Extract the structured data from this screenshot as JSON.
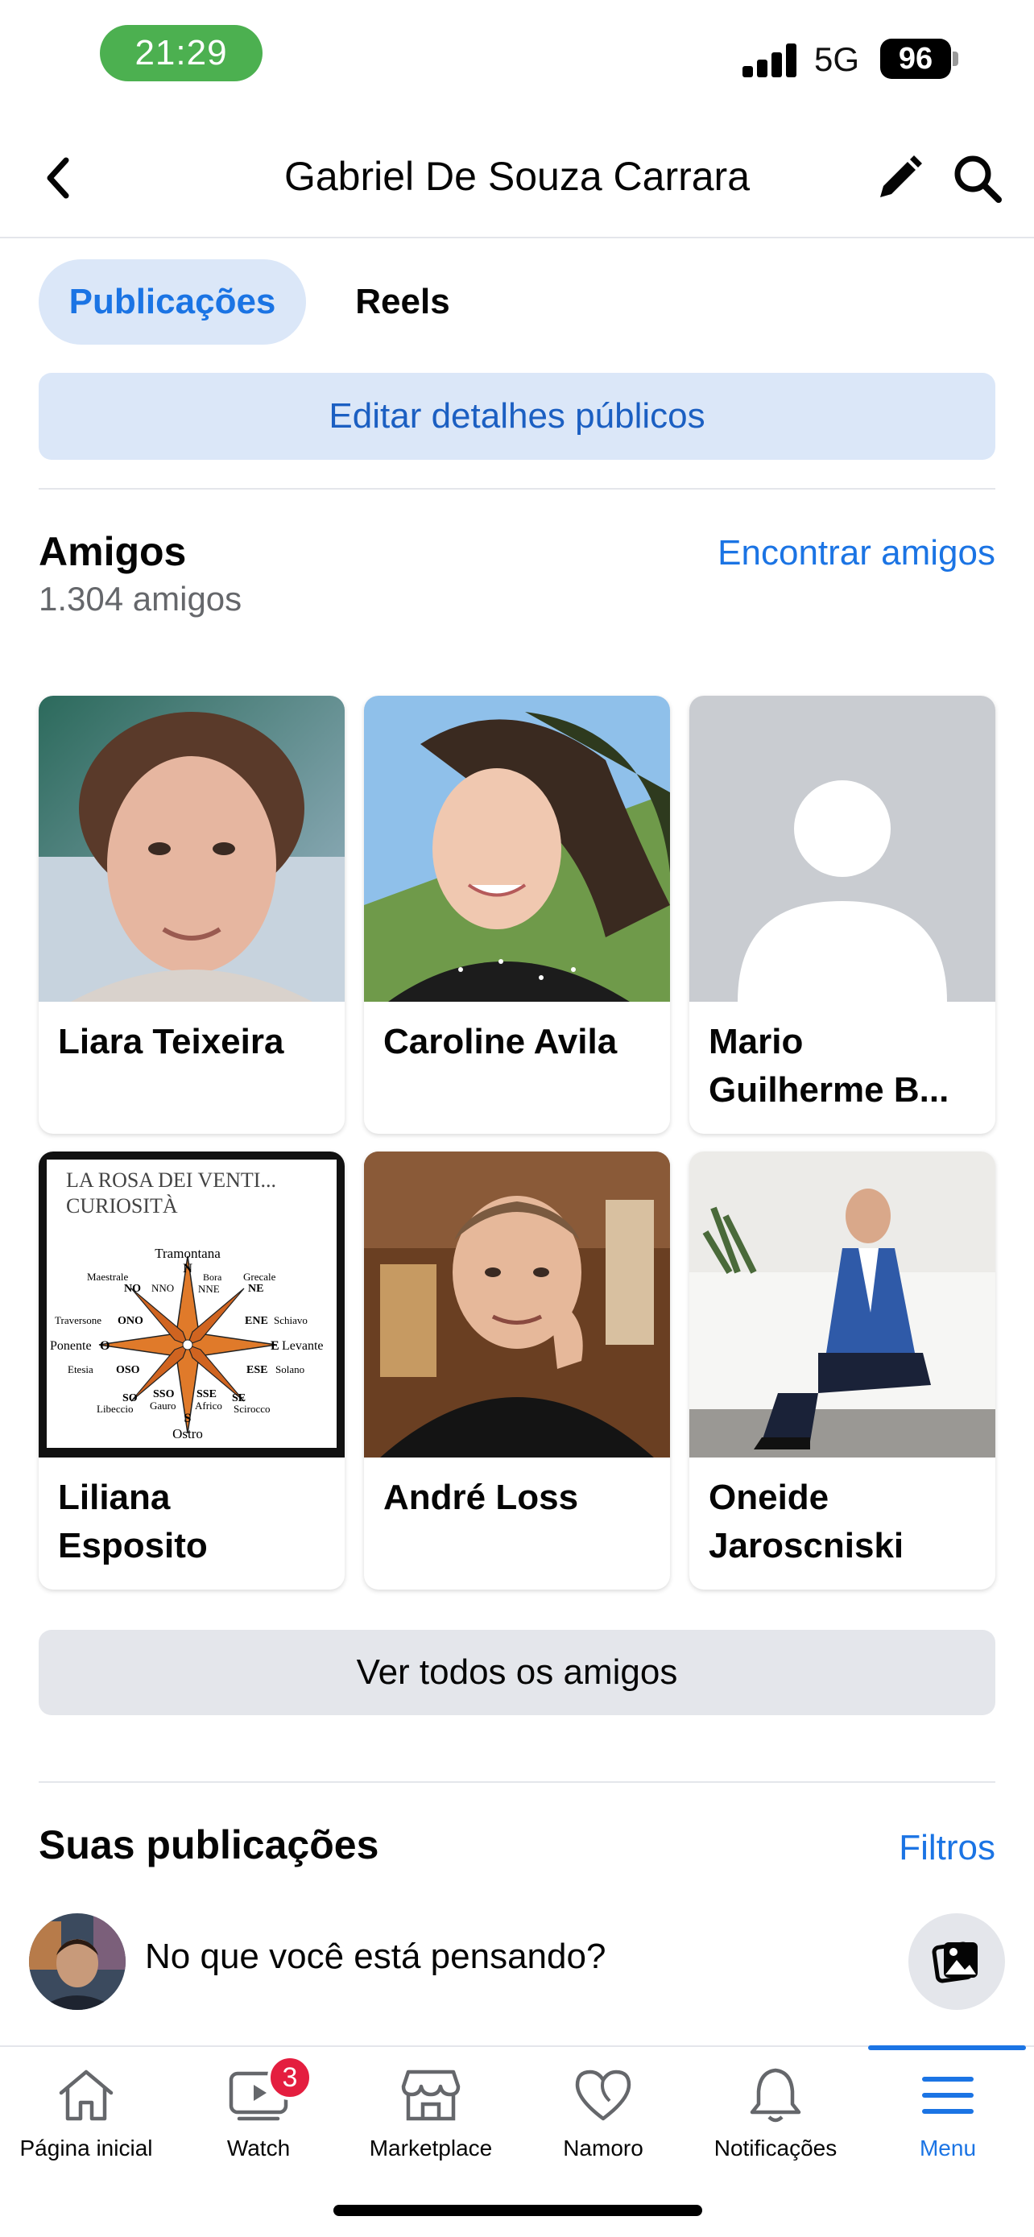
{
  "status_bar": {
    "time": "21:29",
    "network": "5G",
    "battery": "96"
  },
  "header": {
    "title": "Gabriel De Souza Carrara"
  },
  "tabs": [
    {
      "label": "Publicações",
      "active": true
    },
    {
      "label": "Reels",
      "active": false
    }
  ],
  "edit_public_details": "Editar detalhes públicos",
  "friends": {
    "title": "Amigos",
    "count": "1.304 amigos",
    "find_link": "Encontrar amigos",
    "items": [
      {
        "name": "Liara Teixeira",
        "photo": "elderly-woman-portrait"
      },
      {
        "name": "Caroline Avila",
        "photo": "young-woman-outdoor-selfie"
      },
      {
        "name": "Mario Guilherme B...",
        "photo": "default-avatar-silhouette"
      },
      {
        "name": "Liliana Esposito",
        "photo": "compass-rose-image"
      },
      {
        "name": "André Loss",
        "photo": "man-hand-on-cheek"
      },
      {
        "name": "Oneide Jaroscniski",
        "photo": "man-in-blue-suit-seated"
      }
    ],
    "compass_image": {
      "title": "LA ROSA DEI VENTI...",
      "subtitle": "CURIOSITÀ",
      "labels": {
        "top": "Tramontana",
        "n": "N",
        "nw_word": "Maestrale",
        "nw": "NO",
        "nno": "NNO",
        "nne": "NNE",
        "bora": "Bora",
        "ne_word": "Grecale",
        "ne": "NE",
        "ono_word": "Traversone",
        "ono": "ONO",
        "ene": "ENE",
        "ene_word": "Schiavo",
        "west_word": "Ponente",
        "west": "O",
        "east": "E",
        "east_word": "Levante",
        "oso_word": "Etesia",
        "oso": "OSO",
        "ese": "ESE",
        "ese_word": "Solano",
        "so": "SO",
        "sso": "SSO",
        "sse": "SSE",
        "se": "SE",
        "sw_word": "Libeccio",
        "gauro": "Gauro",
        "africo": "Africo",
        "se_word": "Scirocco",
        "s": "S",
        "bottom": "Ostro"
      }
    },
    "see_all": "Ver todos os amigos"
  },
  "posts": {
    "title": "Suas publicações",
    "filters_link": "Filtros",
    "composer_prompt": "No que você está pensando?"
  },
  "bottom_nav": [
    {
      "label": "Página inicial",
      "icon": "home-icon"
    },
    {
      "label": "Watch",
      "icon": "watch-icon",
      "badge": "3"
    },
    {
      "label": "Marketplace",
      "icon": "marketplace-icon"
    },
    {
      "label": "Namoro",
      "icon": "dating-heart-icon"
    },
    {
      "label": "Notificações",
      "icon": "bell-icon"
    },
    {
      "label": "Menu",
      "icon": "menu-icon",
      "active": true
    }
  ],
  "colors": {
    "accent": "#1b74e4",
    "tab_bg": "#dbe7f8",
    "button_gray": "#e4e6eb",
    "badge": "#e41e3f",
    "time_pill": "#4cb050"
  }
}
